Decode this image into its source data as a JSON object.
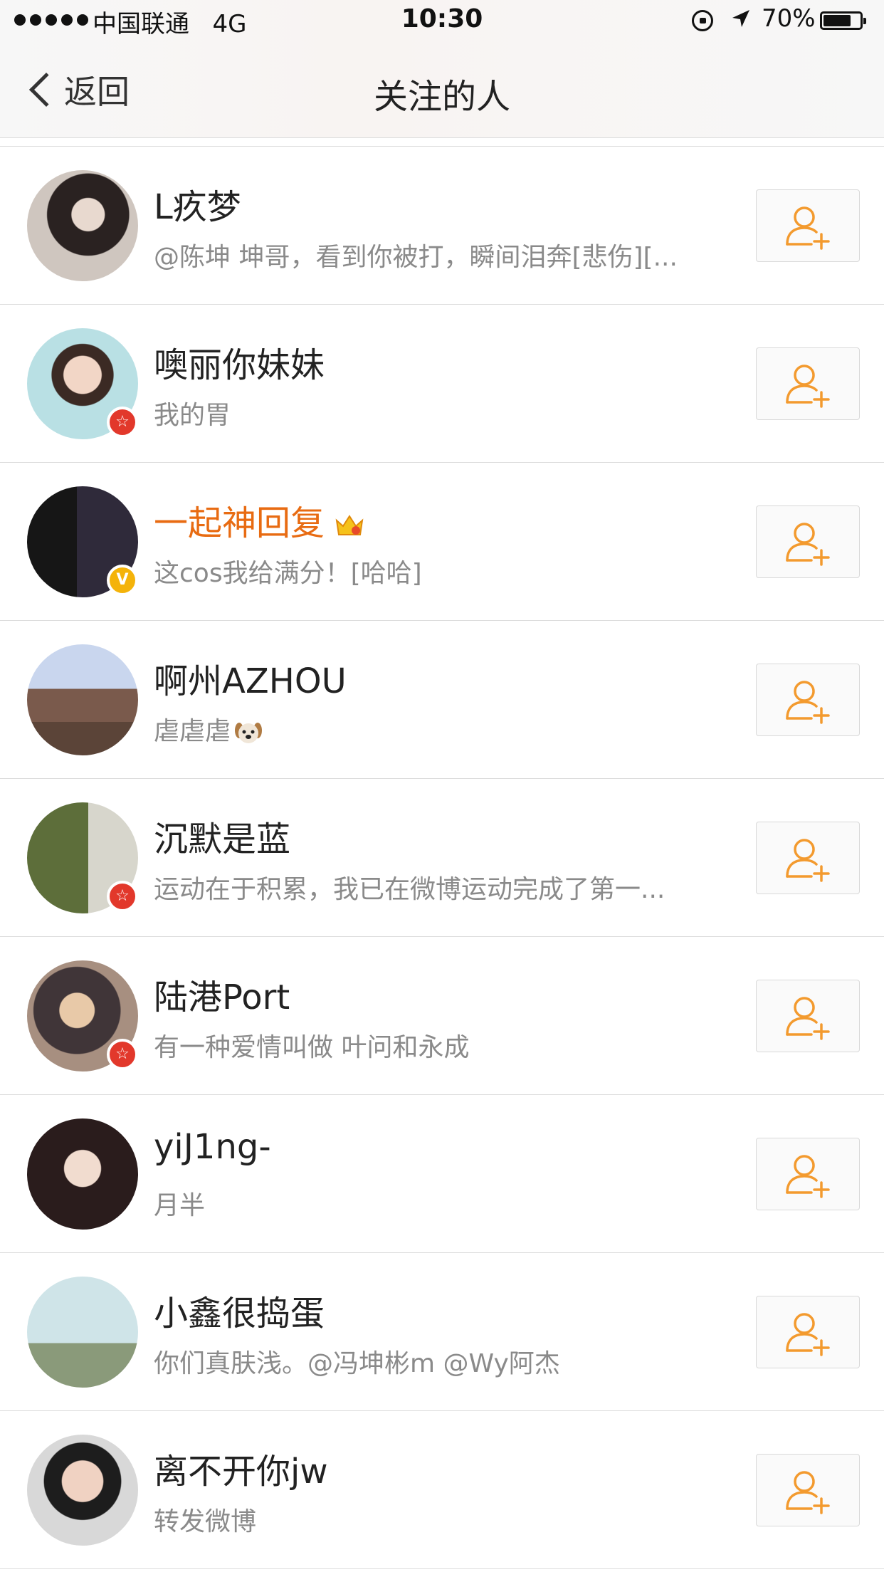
{
  "status_bar": {
    "carrier": "中国联通",
    "network": "4G",
    "time": "10:30",
    "battery": "70%",
    "battery_level": 0.7
  },
  "nav": {
    "back_label": "返回",
    "title": "关注的人"
  },
  "colors": {
    "accent_orange": "#f39a2e",
    "vip_name": "#e86b12",
    "badge_red": "#e2382b",
    "badge_gold": "#f4b30a"
  },
  "follows": [
    {
      "name": "L疚梦",
      "desc": "@陈坤 坤哥，看到你被打，瞬间泪奔[悲伤][...",
      "badge": "",
      "vip": false
    },
    {
      "name": "噢丽你妹妹",
      "desc": "我的胃",
      "badge": "star-red",
      "vip": false
    },
    {
      "name": "一起神回复",
      "desc": "这cos我给满分！[哈哈]",
      "badge": "v-gold",
      "vip": true,
      "icon": "crown-icon"
    },
    {
      "name": "啊州AZHOU",
      "desc": "虐虐虐",
      "badge": "",
      "vip": false,
      "emoji": "dog-face-emoji"
    },
    {
      "name": "沉默是蓝",
      "desc": "运动在于积累，我已在微博运动完成了第一...",
      "badge": "star-red",
      "vip": false
    },
    {
      "name": "陆港Port",
      "desc": "有一种爱情叫做 叶问和永成",
      "badge": "star-red",
      "vip": false
    },
    {
      "name": "yiJ1ng-",
      "desc": "月半",
      "badge": "",
      "vip": false
    },
    {
      "name": "小鑫很捣蛋",
      "desc": "你们真肤浅。@冯坤彬m @Wy阿杰",
      "badge": "",
      "vip": false
    },
    {
      "name": "离不开你jw",
      "desc": "转发微博",
      "badge": "",
      "vip": false
    }
  ]
}
